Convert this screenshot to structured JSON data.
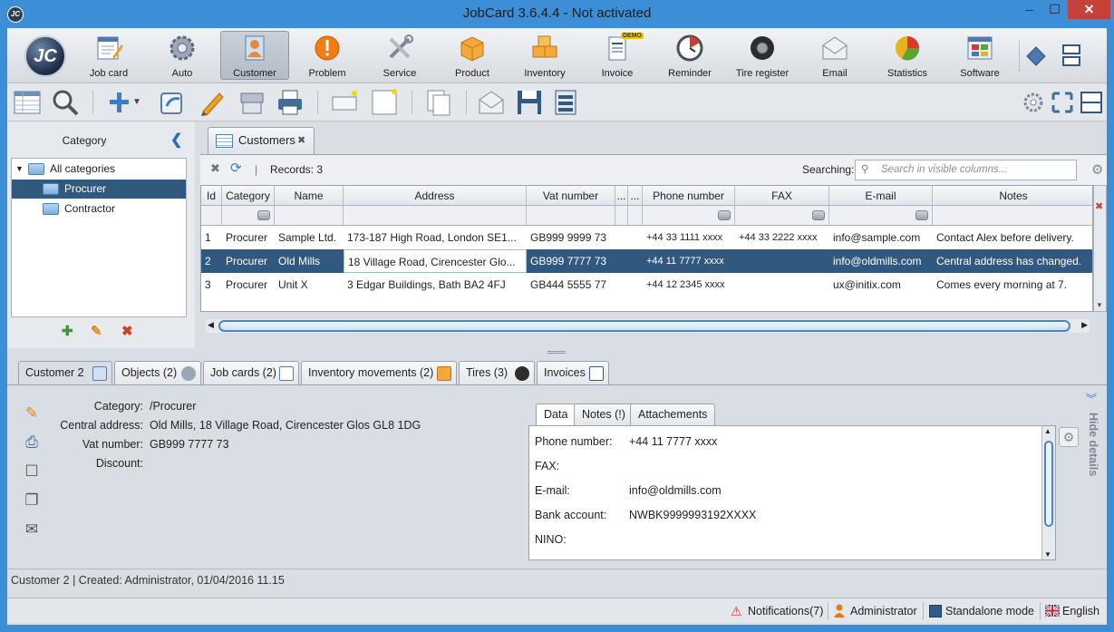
{
  "window": {
    "app_icon": "JC",
    "title": "JobCard 3.6.4.4 - Not activated",
    "controls": {
      "minimize": "–",
      "maximize": "☐",
      "close": "✕"
    }
  },
  "ribbon": {
    "logo": "JC",
    "items": [
      {
        "label": "Job card",
        "icon": "job-card-icon"
      },
      {
        "label": "Auto",
        "icon": "gear-icon"
      },
      {
        "label": "Customer",
        "icon": "customer-icon",
        "active": true
      },
      {
        "label": "Problem",
        "icon": "problem-icon"
      },
      {
        "label": "Service",
        "icon": "tools-icon"
      },
      {
        "label": "Product",
        "icon": "box-icon"
      },
      {
        "label": "Inventory",
        "icon": "boxes-icon"
      },
      {
        "label": "Invoice",
        "icon": "invoice-icon",
        "badge": "DEMO"
      },
      {
        "label": "Reminder",
        "icon": "clock-icon"
      },
      {
        "label": "Tire register",
        "icon": "tire-icon"
      },
      {
        "label": "Email",
        "icon": "envelope-icon"
      },
      {
        "label": "Statistics",
        "icon": "pie-chart-icon"
      },
      {
        "label": "Software",
        "icon": "software-icon"
      }
    ]
  },
  "category_panel": {
    "title": "Category",
    "tree": [
      {
        "label": "All categories",
        "level": 0,
        "expanded": true
      },
      {
        "label": "Procurer",
        "level": 1,
        "selected": true
      },
      {
        "label": "Contractor",
        "level": 1
      }
    ]
  },
  "customers_tab": {
    "label": "Customers",
    "records": "Records: 3",
    "search_label": "Searching:",
    "search_placeholder": "Search in visible columns..."
  },
  "grid": {
    "columns": [
      "Id",
      "Category",
      "Name",
      "Address",
      "Vat number",
      "...",
      "...",
      "Phone number",
      "FAX",
      "E-mail",
      "Notes"
    ],
    "rows": [
      {
        "id": "1",
        "category": "Procurer",
        "name": "Sample Ltd.",
        "address": "173-187 High Road, London SE1...",
        "vat": "GB999 9999 73",
        "phone": "+44 33 1111 xxxx",
        "fax": "+44 33 2222 xxxx",
        "email": "info@sample.com",
        "notes": "Contact Alex before delivery."
      },
      {
        "id": "2",
        "category": "Procurer",
        "name": "Old Mills",
        "address": "18 Village Road, Cirencester Glo...",
        "vat": "GB999 7777 73",
        "phone": "+44 11 7777 xxxx",
        "fax": "",
        "email": "info@oldmills.com",
        "notes": "Central address has changed."
      },
      {
        "id": "3",
        "category": "Procurer",
        "name": "Unit X",
        "address": "3 Edgar Buildings, Bath BA2 4FJ",
        "vat": "GB444 5555 77",
        "phone": "+44 12 2345 xxxx",
        "fax": "",
        "email": "ux@initix.com",
        "notes": "Comes every morning at 7."
      }
    ],
    "selected_row": 1
  },
  "bottom_tabs": [
    {
      "label": "Customer 2",
      "active": true
    },
    {
      "label": "Objects (2)"
    },
    {
      "label": "Job cards (2)"
    },
    {
      "label": "Inventory movements (2)"
    },
    {
      "label": "Tires (3)"
    },
    {
      "label": "Invoices"
    }
  ],
  "details": {
    "fields": [
      {
        "label": "Category:",
        "value": "/Procurer"
      },
      {
        "label": "Central address:",
        "value": "Old Mills, 18 Village Road, Cirencester Glos GL8 1DG"
      },
      {
        "label": "Vat number:",
        "value": "GB999 7777 73"
      },
      {
        "label": "Discount:",
        "value": ""
      }
    ],
    "subtabs": [
      "Data",
      "Notes (!)",
      "Attachements"
    ],
    "data_fields": [
      {
        "label": "Phone number:",
        "value": "+44 11 7777 xxxx"
      },
      {
        "label": "FAX:",
        "value": ""
      },
      {
        "label": "E-mail:",
        "value": "info@oldmills.com"
      },
      {
        "label": "Bank account:",
        "value": "NWBK9999993192XXXX"
      },
      {
        "label": "NINO:",
        "value": ""
      }
    ],
    "hide_details": "Hide details"
  },
  "created_line": "Customer 2 | Created: Administrator, 01/04/2016 11.15",
  "statusbar": {
    "notifications": "Notifications(7)",
    "user": "Administrator",
    "mode": "Standalone mode",
    "language": "English"
  }
}
